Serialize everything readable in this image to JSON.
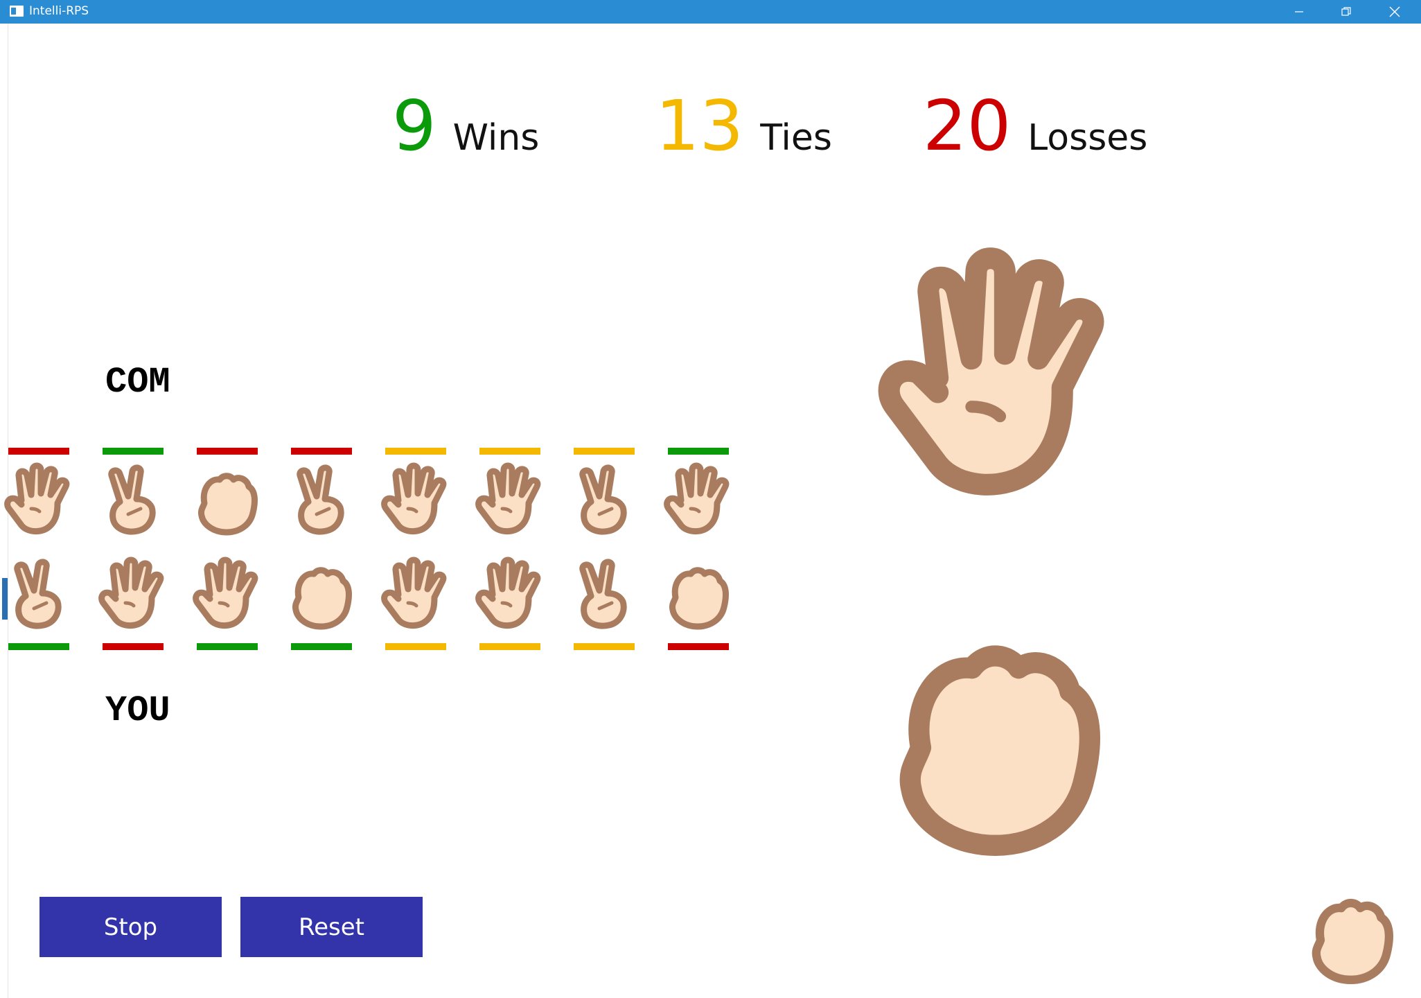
{
  "window": {
    "title": "Intelli-RPS"
  },
  "score": {
    "wins": {
      "value": "9",
      "label": "Wins",
      "color": "#0a9a0a"
    },
    "ties": {
      "value": "13",
      "label": "Ties",
      "color": "#f5b800"
    },
    "losses": {
      "value": "20",
      "label": "Losses",
      "color": "#cc0000"
    }
  },
  "history": {
    "com_label": "COM",
    "you_label": "YOU",
    "com_moves": [
      "paper",
      "scissors",
      "rock",
      "scissors",
      "paper",
      "paper",
      "scissors",
      "paper"
    ],
    "you_moves": [
      "scissors",
      "paper",
      "paper",
      "rock",
      "paper",
      "paper",
      "scissors",
      "rock"
    ],
    "com_results": [
      "loss",
      "win",
      "loss",
      "loss",
      "tie",
      "tie",
      "tie",
      "win"
    ],
    "you_results": [
      "win",
      "loss",
      "win",
      "win",
      "tie",
      "tie",
      "tie",
      "loss"
    ]
  },
  "colors": {
    "win": "#0a9a0a",
    "tie": "#f5b800",
    "loss": "#cc0000",
    "skin_fill": "#fbe0c6",
    "skin_stroke": "#a97c5f",
    "button": "#3333aa"
  },
  "current": {
    "com_move": "paper",
    "you_move": "rock",
    "next_hint": "rock"
  },
  "controls": {
    "stop_label": "Stop",
    "reset_label": "Reset"
  }
}
